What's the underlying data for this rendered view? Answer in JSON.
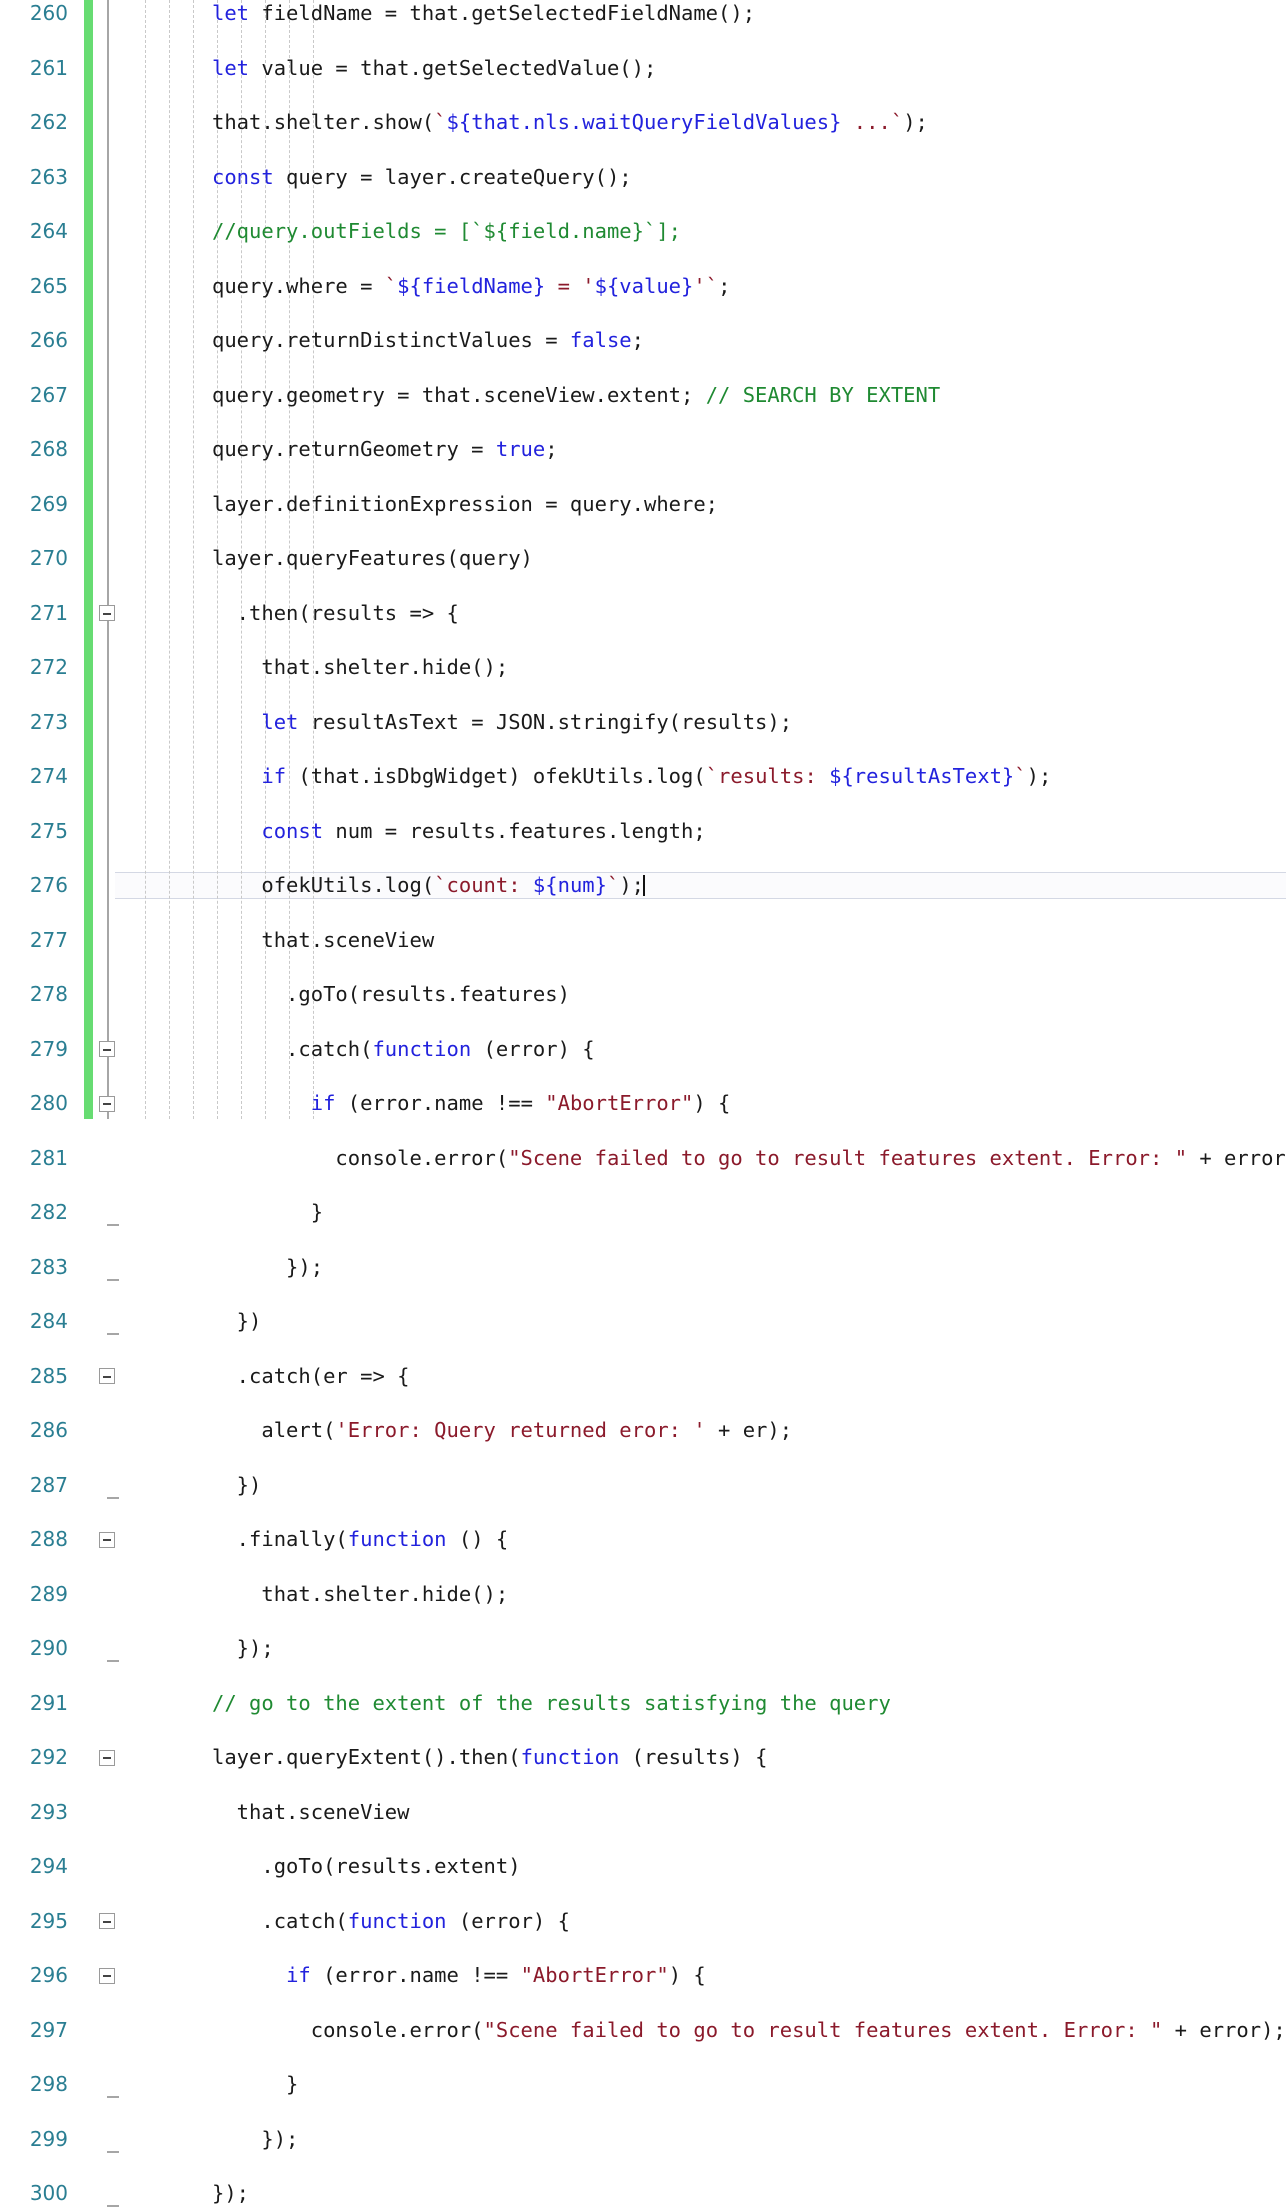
{
  "editor": {
    "app": "code-editor",
    "language": "javascript",
    "first_line_number": 260,
    "last_line_number": 300,
    "caret_line_number": 276,
    "colors": {
      "background": "#ffffff",
      "text": "#1a1a1a",
      "keyword": "#2222dd",
      "comment": "#1f8a32",
      "string": "#8b1a2b",
      "template_substitution": "#2222dd",
      "line_number": "#2a7e92",
      "change_bar_added": "#67dc72",
      "fold_line": "#a6a6a6",
      "indent_guide": "#c9c9c9",
      "caret_line_background": "#fbfbfd",
      "caret_line_border": "#d4d8e4"
    },
    "gutter": {
      "change_bar_name": "vcs-added-change-bar",
      "fold_column_name": "code-folding-column"
    },
    "indent_guide_x_positions": [
      145,
      169,
      193,
      217,
      241,
      265,
      289,
      313
    ],
    "lines": [
      {
        "num": "260",
        "indent": 0,
        "fold": false,
        "foldtick": false,
        "tokens": [
          {
            "t": "kw",
            "s": "let"
          },
          {
            "t": "pln",
            "s": " fieldName = that.getSelectedFieldName();"
          }
        ]
      },
      {
        "num": "261",
        "indent": 0,
        "fold": false,
        "foldtick": false,
        "tokens": [
          {
            "t": "kw",
            "s": "let"
          },
          {
            "t": "pln",
            "s": " value = that.getSelectedValue();"
          }
        ]
      },
      {
        "num": "262",
        "indent": 0,
        "fold": false,
        "foldtick": false,
        "tokens": [
          {
            "t": "pln",
            "s": "that.shelter.show("
          },
          {
            "t": "tpl",
            "s": "`"
          },
          {
            "t": "sub",
            "s": "${that.nls.waitQueryFieldValues}"
          },
          {
            "t": "tpl",
            "s": " ...`"
          },
          {
            "t": "pln",
            "s": ");"
          }
        ]
      },
      {
        "num": "263",
        "indent": 0,
        "fold": false,
        "foldtick": false,
        "tokens": [
          {
            "t": "kw",
            "s": "const"
          },
          {
            "t": "pln",
            "s": " query = layer.createQuery();"
          }
        ]
      },
      {
        "num": "264",
        "indent": 0,
        "fold": false,
        "foldtick": false,
        "tokens": [
          {
            "t": "cmt",
            "s": "//query.outFields = [`${field.name}`];"
          }
        ]
      },
      {
        "num": "265",
        "indent": 0,
        "fold": false,
        "foldtick": false,
        "tokens": [
          {
            "t": "pln",
            "s": "query.where = "
          },
          {
            "t": "tpl",
            "s": "`"
          },
          {
            "t": "sub",
            "s": "${fieldName}"
          },
          {
            "t": "tpl",
            "s": " = '"
          },
          {
            "t": "sub",
            "s": "${value}"
          },
          {
            "t": "tpl",
            "s": "'`"
          },
          {
            "t": "pln",
            "s": ";"
          }
        ]
      },
      {
        "num": "266",
        "indent": 0,
        "fold": false,
        "foldtick": false,
        "tokens": [
          {
            "t": "pln",
            "s": "query.returnDistinctValues = "
          },
          {
            "t": "kw",
            "s": "false"
          },
          {
            "t": "pln",
            "s": ";"
          }
        ]
      },
      {
        "num": "267",
        "indent": 0,
        "fold": false,
        "foldtick": false,
        "tokens": [
          {
            "t": "pln",
            "s": "query.geometry = that.sceneView.extent; "
          },
          {
            "t": "cmt",
            "s": "// SEARCH BY EXTENT"
          }
        ]
      },
      {
        "num": "268",
        "indent": 0,
        "fold": false,
        "foldtick": false,
        "tokens": [
          {
            "t": "pln",
            "s": "query.returnGeometry = "
          },
          {
            "t": "kw",
            "s": "true"
          },
          {
            "t": "pln",
            "s": ";"
          }
        ]
      },
      {
        "num": "269",
        "indent": 0,
        "fold": false,
        "foldtick": false,
        "tokens": [
          {
            "t": "pln",
            "s": "layer.definitionExpression = query.where;"
          }
        ]
      },
      {
        "num": "270",
        "indent": 0,
        "fold": false,
        "foldtick": false,
        "tokens": [
          {
            "t": "pln",
            "s": "layer.queryFeatures(query)"
          }
        ]
      },
      {
        "num": "271",
        "indent": 2,
        "fold": true,
        "foldtick": false,
        "tokens": [
          {
            "t": "pln",
            "s": "  .then(results => {"
          }
        ]
      },
      {
        "num": "272",
        "indent": 4,
        "fold": false,
        "foldtick": false,
        "tokens": [
          {
            "t": "pln",
            "s": "    that.shelter.hide();"
          }
        ]
      },
      {
        "num": "273",
        "indent": 4,
        "fold": false,
        "foldtick": false,
        "tokens": [
          {
            "t": "pln",
            "s": "    "
          },
          {
            "t": "kw",
            "s": "let"
          },
          {
            "t": "pln",
            "s": " resultAsText = JSON.stringify(results);"
          }
        ]
      },
      {
        "num": "274",
        "indent": 4,
        "fold": false,
        "foldtick": false,
        "tokens": [
          {
            "t": "pln",
            "s": "    "
          },
          {
            "t": "kw",
            "s": "if"
          },
          {
            "t": "pln",
            "s": " (that.isDbgWidget) ofekUtils.log("
          },
          {
            "t": "tpl",
            "s": "`results: "
          },
          {
            "t": "sub",
            "s": "${resultAsText}"
          },
          {
            "t": "tpl",
            "s": "`"
          },
          {
            "t": "pln",
            "s": ");"
          }
        ]
      },
      {
        "num": "275",
        "indent": 4,
        "fold": false,
        "foldtick": false,
        "tokens": [
          {
            "t": "pln",
            "s": "    "
          },
          {
            "t": "kw",
            "s": "const"
          },
          {
            "t": "pln",
            "s": " num = results.features.length;"
          }
        ]
      },
      {
        "num": "276",
        "indent": 4,
        "fold": false,
        "foldtick": false,
        "caret": true,
        "tokens": [
          {
            "t": "pln",
            "s": "    ofekUtils.log("
          },
          {
            "t": "tpl",
            "s": "`count: "
          },
          {
            "t": "sub",
            "s": "${num}"
          },
          {
            "t": "tpl",
            "s": "`"
          },
          {
            "t": "pln",
            "s": ");"
          }
        ]
      },
      {
        "num": "277",
        "indent": 4,
        "fold": false,
        "foldtick": false,
        "tokens": [
          {
            "t": "pln",
            "s": "    that.sceneView"
          }
        ]
      },
      {
        "num": "278",
        "indent": 6,
        "fold": false,
        "foldtick": false,
        "tokens": [
          {
            "t": "pln",
            "s": "      .goTo(results.features)"
          }
        ]
      },
      {
        "num": "279",
        "indent": 6,
        "fold": true,
        "foldtick": false,
        "tokens": [
          {
            "t": "pln",
            "s": "      .catch("
          },
          {
            "t": "kw",
            "s": "function"
          },
          {
            "t": "pln",
            "s": " (error) {"
          }
        ]
      },
      {
        "num": "280",
        "indent": 8,
        "fold": true,
        "foldtick": false,
        "tokens": [
          {
            "t": "pln",
            "s": "        "
          },
          {
            "t": "kw",
            "s": "if"
          },
          {
            "t": "pln",
            "s": " (error.name !== "
          },
          {
            "t": "str",
            "s": "\"AbortError\""
          },
          {
            "t": "pln",
            "s": ") {"
          }
        ]
      },
      {
        "num": "281",
        "indent": 10,
        "fold": false,
        "foldtick": false,
        "tokens": [
          {
            "t": "pln",
            "s": "          console.error("
          },
          {
            "t": "str",
            "s": "\"Scene failed to go to result features extent. Error: \""
          },
          {
            "t": "pln",
            "s": " + error);"
          }
        ]
      },
      {
        "num": "282",
        "indent": 8,
        "fold": false,
        "foldtick": true,
        "tokens": [
          {
            "t": "pln",
            "s": "        }"
          }
        ]
      },
      {
        "num": "283",
        "indent": 6,
        "fold": false,
        "foldtick": true,
        "tokens": [
          {
            "t": "pln",
            "s": "      });"
          }
        ]
      },
      {
        "num": "284",
        "indent": 2,
        "fold": false,
        "foldtick": true,
        "tokens": [
          {
            "t": "pln",
            "s": "  })"
          }
        ]
      },
      {
        "num": "285",
        "indent": 2,
        "fold": true,
        "foldtick": false,
        "tokens": [
          {
            "t": "pln",
            "s": "  .catch(er => {"
          }
        ]
      },
      {
        "num": "286",
        "indent": 4,
        "fold": false,
        "foldtick": false,
        "tokens": [
          {
            "t": "pln",
            "s": "    alert("
          },
          {
            "t": "str",
            "s": "'Error: Query returned eror: '"
          },
          {
            "t": "pln",
            "s": " + er);"
          }
        ]
      },
      {
        "num": "287",
        "indent": 2,
        "fold": false,
        "foldtick": true,
        "tokens": [
          {
            "t": "pln",
            "s": "  })"
          }
        ]
      },
      {
        "num": "288",
        "indent": 2,
        "fold": true,
        "foldtick": false,
        "tokens": [
          {
            "t": "pln",
            "s": "  .finally("
          },
          {
            "t": "kw",
            "s": "function"
          },
          {
            "t": "pln",
            "s": " () {"
          }
        ]
      },
      {
        "num": "289",
        "indent": 4,
        "fold": false,
        "foldtick": false,
        "tokens": [
          {
            "t": "pln",
            "s": "    that.shelter.hide();"
          }
        ]
      },
      {
        "num": "290",
        "indent": 2,
        "fold": false,
        "foldtick": true,
        "tokens": [
          {
            "t": "pln",
            "s": "  });"
          }
        ]
      },
      {
        "num": "291",
        "indent": 0,
        "fold": false,
        "foldtick": false,
        "tokens": [
          {
            "t": "cmt",
            "s": "// go to the extent of the results satisfying the query"
          }
        ]
      },
      {
        "num": "292",
        "indent": 0,
        "fold": true,
        "foldtick": false,
        "tokens": [
          {
            "t": "pln",
            "s": "layer.queryExtent().then("
          },
          {
            "t": "kw",
            "s": "function"
          },
          {
            "t": "pln",
            "s": " (results) {"
          }
        ]
      },
      {
        "num": "293",
        "indent": 2,
        "fold": false,
        "foldtick": false,
        "tokens": [
          {
            "t": "pln",
            "s": "  that.sceneView"
          }
        ]
      },
      {
        "num": "294",
        "indent": 4,
        "fold": false,
        "foldtick": false,
        "tokens": [
          {
            "t": "pln",
            "s": "    .goTo(results.extent)"
          }
        ]
      },
      {
        "num": "295",
        "indent": 4,
        "fold": true,
        "foldtick": false,
        "tokens": [
          {
            "t": "pln",
            "s": "    .catch("
          },
          {
            "t": "kw",
            "s": "function"
          },
          {
            "t": "pln",
            "s": " (error) {"
          }
        ]
      },
      {
        "num": "296",
        "indent": 6,
        "fold": true,
        "foldtick": false,
        "tokens": [
          {
            "t": "pln",
            "s": "      "
          },
          {
            "t": "kw",
            "s": "if"
          },
          {
            "t": "pln",
            "s": " (error.name !== "
          },
          {
            "t": "str",
            "s": "\"AbortError\""
          },
          {
            "t": "pln",
            "s": ") {"
          }
        ]
      },
      {
        "num": "297",
        "indent": 8,
        "fold": false,
        "foldtick": false,
        "tokens": [
          {
            "t": "pln",
            "s": "        console.error("
          },
          {
            "t": "str",
            "s": "\"Scene failed to go to result features extent. Error: \""
          },
          {
            "t": "pln",
            "s": " + error);"
          }
        ]
      },
      {
        "num": "298",
        "indent": 6,
        "fold": false,
        "foldtick": true,
        "tokens": [
          {
            "t": "pln",
            "s": "      }"
          }
        ]
      },
      {
        "num": "299",
        "indent": 4,
        "fold": false,
        "foldtick": true,
        "tokens": [
          {
            "t": "pln",
            "s": "    });"
          }
        ]
      },
      {
        "num": "300",
        "indent": 0,
        "fold": false,
        "foldtick": true,
        "tokens": [
          {
            "t": "pln",
            "s": "});"
          }
        ]
      }
    ]
  }
}
